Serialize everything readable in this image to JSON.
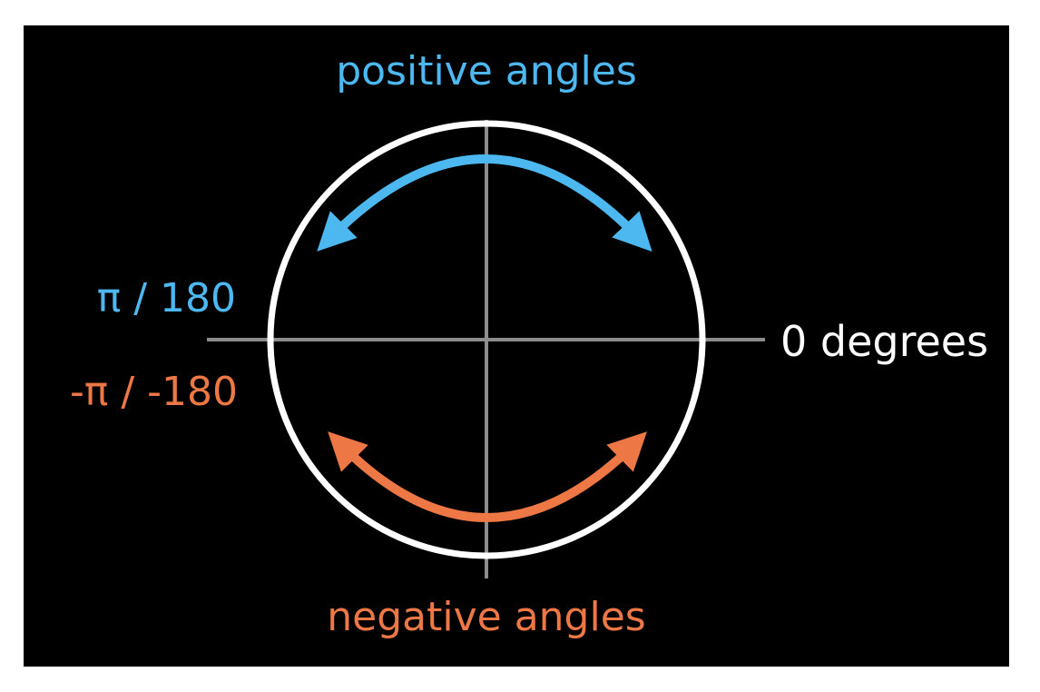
{
  "labels": {
    "positive": "positive angles",
    "negative": "negative angles",
    "zero": "0 degrees",
    "pi_positive": "π / 180",
    "pi_negative": "-π / -180"
  },
  "colors": {
    "background": "#000000",
    "axis": "#8c8c8c",
    "circle": "#ffffff",
    "positive": "#4db8f0",
    "negative": "#ee7845",
    "zero_label": "#ffffff"
  }
}
